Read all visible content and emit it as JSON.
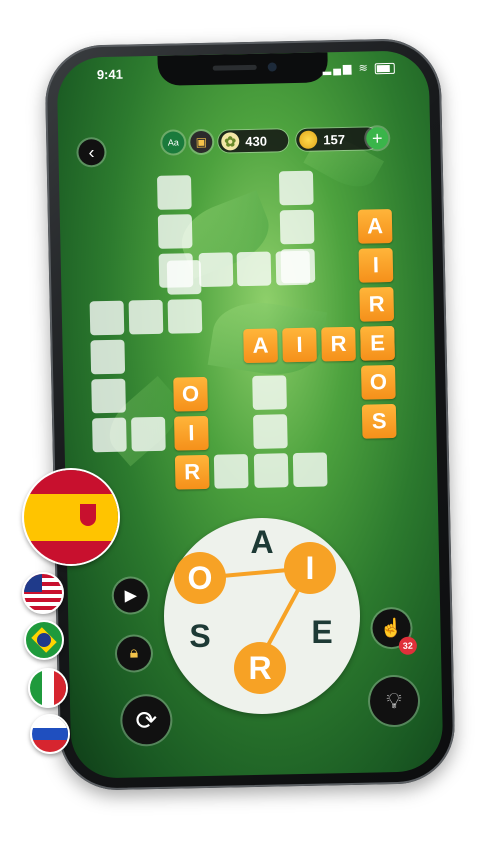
{
  "status": {
    "time": "9:41"
  },
  "hud": {
    "back_icon": "chevron-left-icon",
    "stars": "430",
    "coins": "157",
    "plus": "+",
    "letters_badge": "Aa"
  },
  "grid": {
    "placed_words": [
      "AIREOS",
      "AIRE",
      "OIR"
    ],
    "letters": {
      "v1": [
        "A",
        "I",
        "R",
        "E",
        "O",
        "S"
      ],
      "h1": [
        "A",
        "I",
        "R",
        "E"
      ],
      "v2": [
        "O",
        "I",
        "R"
      ]
    }
  },
  "wheel": {
    "letters": [
      "A",
      "O",
      "I",
      "S",
      "E",
      "R"
    ],
    "selected": [
      "O",
      "I",
      "R"
    ],
    "accent": "#f7a225"
  },
  "tools": {
    "hand_count": "32"
  },
  "languages": [
    "spanish-flag",
    "us-flag",
    "brazil-flag",
    "italy-flag",
    "russia-flag"
  ],
  "colors": {
    "tile": "#f5901a",
    "background": "#2c7a2e"
  }
}
